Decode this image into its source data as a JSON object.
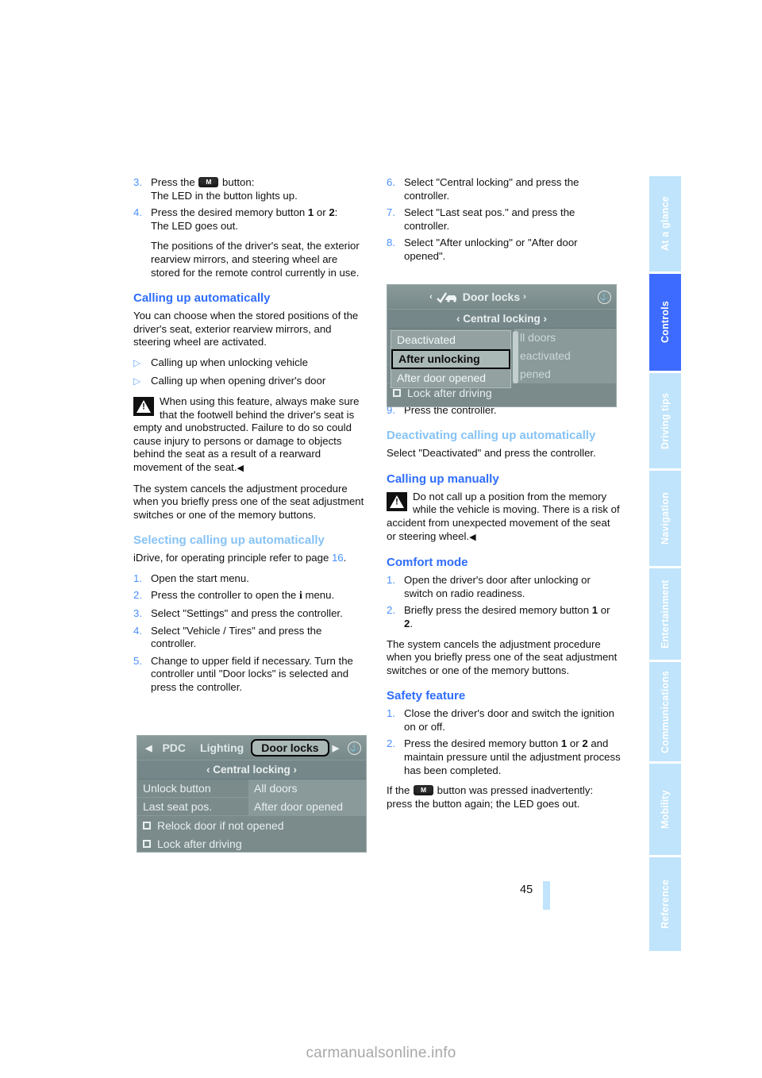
{
  "page": {
    "number": "45",
    "watermark": "carmanualsonline.info"
  },
  "tabs": [
    {
      "label": "At a glance",
      "active": false
    },
    {
      "label": "Controls",
      "active": true
    },
    {
      "label": "Driving tips",
      "active": false
    },
    {
      "label": "Navigation",
      "active": false
    },
    {
      "label": "Entertainment",
      "active": false
    },
    {
      "label": "Communications",
      "active": false
    },
    {
      "label": "Mobility",
      "active": false
    },
    {
      "label": "Reference",
      "active": false
    }
  ],
  "left_column": {
    "steps_top": [
      {
        "num": "3.",
        "line1_pre": "Press the ",
        "line1_post": " button:",
        "line2": "The LED in the button lights up."
      },
      {
        "num": "4.",
        "line1_pre": "Press the desired memory button ",
        "bold1": "1",
        "mid": " or ",
        "bold2": "2",
        "line1_post": ":",
        "line2": "The LED goes out."
      }
    ],
    "step4_note": "The positions of the driver's seat, the exterior rearview mirrors, and steering wheel are stored for the remote control currently in use.",
    "heading_calling_auto": "Calling up automatically",
    "para_calling_auto": "You can choose when the stored positions of the driver's seat, exterior rearview mirrors, and steering wheel are activated.",
    "bullets": [
      "Calling up when unlocking vehicle",
      "Calling up when opening driver's door"
    ],
    "warning": "When using this feature, always make sure that the footwell behind the driver's seat is empty and unobstructed. Failure to do so could cause injury to persons or damage to objects behind the seat as a result of a rearward movement of the seat.",
    "para_cancel": "The system cancels the adjustment procedure when you briefly press one of the seat adjustment switches or one of the memory buttons.",
    "heading_selecting": "Selecting calling up automatically",
    "idrive_ref_pre": "iDrive, for operating principle refer to page ",
    "idrive_ref_page": "16",
    "idrive_ref_post": ".",
    "steps_select": [
      {
        "num": "1.",
        "text": "Open the start menu."
      },
      {
        "num": "2.",
        "text_pre": "Press the controller to open the ",
        "icon": "i",
        "text_post": " menu."
      },
      {
        "num": "3.",
        "text": "Select \"Settings\" and press the controller."
      },
      {
        "num": "4.",
        "text": "Select \"Vehicle / Tires\" and press the controller."
      },
      {
        "num": "5.",
        "text": "Change to upper field if necessary. Turn the controller until \"Door locks\" is selected and press the controller."
      }
    ]
  },
  "right_column": {
    "steps_top": [
      {
        "num": "6.",
        "text": "Select \"Central locking\" and press the controller."
      },
      {
        "num": "7.",
        "text": "Select \"Last seat pos.\" and press the controller."
      },
      {
        "num": "8.",
        "text": "Select \"After unlocking\" or \"After door opened\"."
      }
    ],
    "step9": {
      "num": "9.",
      "text": "Press the controller."
    },
    "heading_deactivating": "Deactivating calling up automatically",
    "para_deactivating": "Select \"Deactivated\" and press the controller.",
    "heading_manually": "Calling up manually",
    "warning_manual": "Do not call up a position from the memory while the vehicle is moving. There is a risk of accident from unexpected movement of the seat or steering wheel.",
    "heading_comfort": "Comfort mode",
    "steps_comfort": [
      {
        "num": "1.",
        "text": "Open the driver's door after unlocking or switch on radio readiness."
      },
      {
        "num": "2.",
        "text_pre": "Briefly press the desired memory button ",
        "bold1": "1",
        "mid": " or ",
        "bold2": "2",
        "text_post": "."
      }
    ],
    "para_cancel": "The system cancels the adjustment procedure when you briefly press one of the seat adjustment switches or one of the memory buttons.",
    "heading_safety": "Safety feature",
    "steps_safety": [
      {
        "num": "1.",
        "text": "Close the driver's door and switch the ignition on or off."
      },
      {
        "num": "2.",
        "text_pre": "Press the desired memory button ",
        "bold1": "1",
        "mid": " or ",
        "bold2": "2",
        "text_post": " and maintain pressure until the adjustment process has been completed."
      }
    ],
    "final_pre": "If the ",
    "final_post": " button was pressed inadvertently: press the button again; the LED goes out."
  },
  "idrive_left": {
    "topbar": {
      "left_arrow": "◀",
      "item1": "PDC",
      "item2": "Lighting",
      "selected": "Door locks",
      "right_arrow": "▶",
      "anchor_icon": "anchor-icon"
    },
    "subbar": "‹ Central locking ›",
    "rows": [
      {
        "label": "Unlock button",
        "value": "All doors"
      },
      {
        "label": "Last seat pos.",
        "value": "After door opened"
      }
    ],
    "checks": [
      "Relock door if not opened",
      "Lock after driving"
    ]
  },
  "idrive_right": {
    "topbar": {
      "left_arrow": "‹",
      "title": "Door locks",
      "right_arrow": "›",
      "car_icon": "checked-car-icon",
      "anchor_icon": "anchor-icon"
    },
    "subbar": "‹ Central locking ›",
    "background_rows": [
      "ll doors",
      "eactivated",
      "pened"
    ],
    "popup_items": [
      {
        "label": "Deactivated",
        "selected": false
      },
      {
        "label": "After unlocking",
        "selected": true
      },
      {
        "label": "After door opened",
        "selected": false
      }
    ],
    "check": "Lock after driving"
  },
  "colors": {
    "heading_blue": "#2f6dfb",
    "heading_light_blue": "#87c3f5",
    "tab_inactive": "#bfe4fb",
    "tab_active": "#3d6bff",
    "list_number": "#4a90ff",
    "idrive_bg": "#7f8f8f"
  }
}
